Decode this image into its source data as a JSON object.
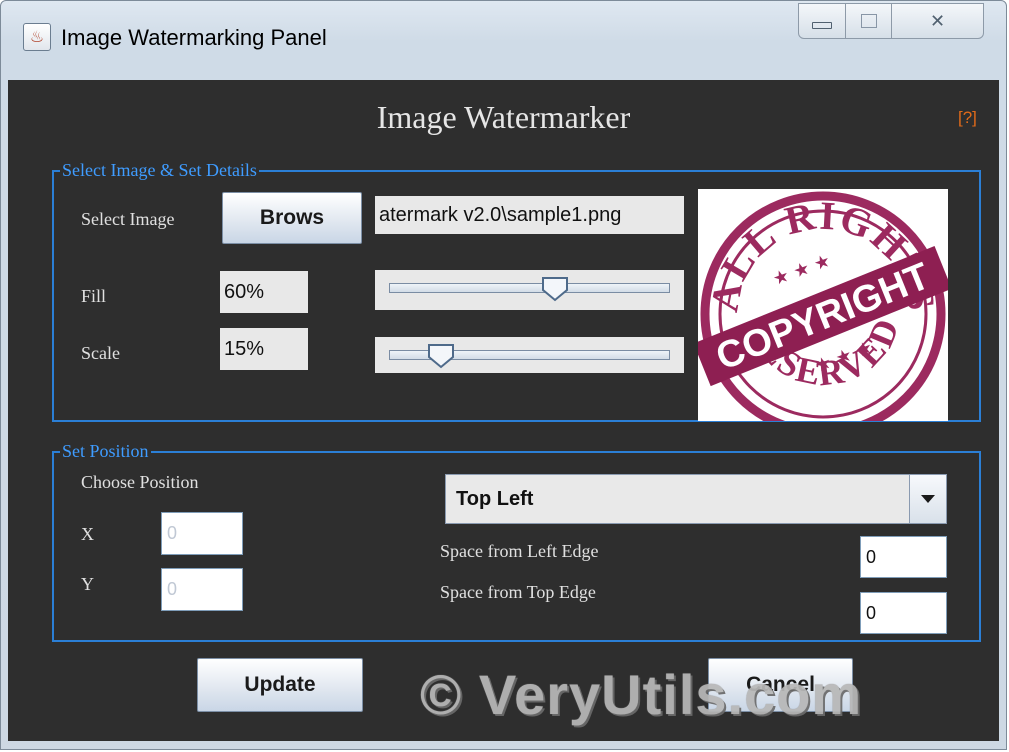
{
  "window": {
    "title": "Image Watermarking Panel",
    "controls": {
      "minimize": "minimize",
      "maximize": "maximize",
      "close": "close"
    }
  },
  "header": {
    "title": "Image Watermarker",
    "help_link": "[?]"
  },
  "details": {
    "legend": "Select Image & Set Details",
    "select_image_label": "Select Image",
    "browse_button": "Brows",
    "file_path": "atermark v2.0\\sample1.png",
    "fill_label": "Fill",
    "fill_value": "60%",
    "fill_level": 0.6,
    "scale_label": "Scale",
    "scale_value": "15%",
    "scale_level": 0.15,
    "preview": {
      "arc_top": "ALL RIGHTS",
      "banner": "COPYRIGHT",
      "arc_bottom": "RESERVED",
      "stars": "★ ★ ★",
      "color": "#9c2a5f"
    }
  },
  "position": {
    "legend": "Set Position",
    "choose_label": "Choose Position",
    "x_label": "X",
    "x_value": "0",
    "y_label": "Y",
    "y_value": "0",
    "selected": "Top Left",
    "left_edge_label": "Space from Left Edge",
    "left_edge_value": "0",
    "top_edge_label": "Space from Top Edge",
    "top_edge_value": "0"
  },
  "actions": {
    "update": "Update",
    "cancel": "Cancel"
  },
  "overlay_watermark": "© VeryUtils.com",
  "colors": {
    "panel_bg": "#2e2e2e",
    "border_accent": "#2b7fd6",
    "help": "#e06a1a",
    "stamp": "#9c2a5f"
  }
}
